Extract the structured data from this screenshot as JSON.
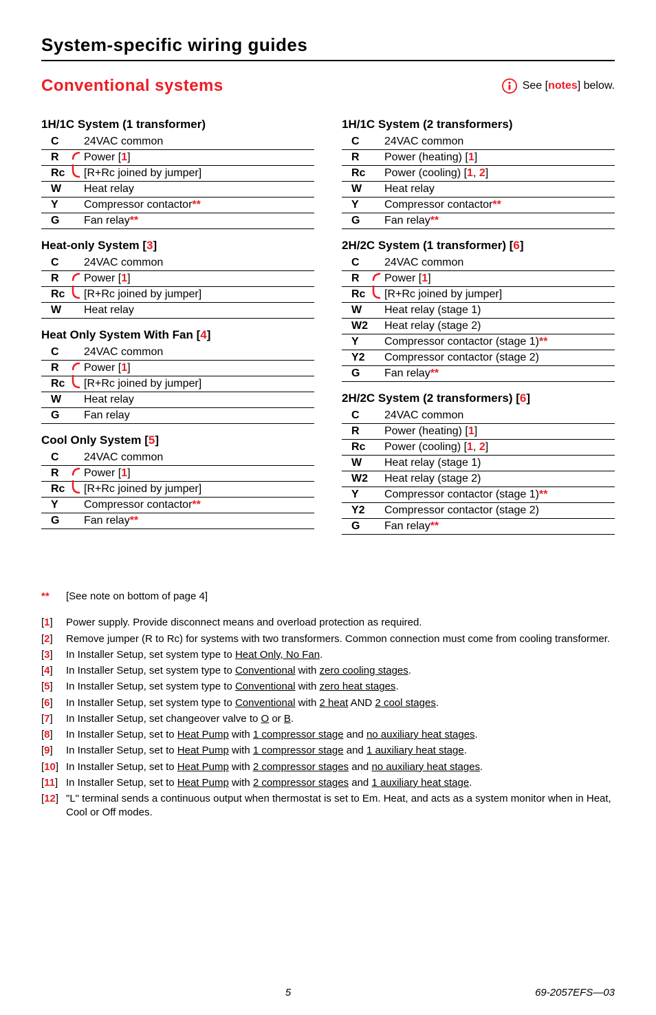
{
  "header": "System-specific wiring guides",
  "section": "Conventional systems",
  "info_notes": {
    "pre": "See [",
    "mid": "notes",
    "post": "] below."
  },
  "systems": {
    "s1": {
      "title": "1H/1C System (1 transformer)",
      "rows": [
        {
          "term": "C",
          "desc": "24VAC common",
          "j": ""
        },
        {
          "term": "R",
          "desc_pre": "Power [",
          "ref": "1",
          "desc_post": "]",
          "j": "top"
        },
        {
          "term": "Rc",
          "desc": "[R+Rc joined by jumper]",
          "j": "bot"
        },
        {
          "term": "W",
          "desc": "Heat relay",
          "j": ""
        },
        {
          "term": "Y",
          "desc_pre": "Compressor contactor",
          "star": "**",
          "j": ""
        },
        {
          "term": "G",
          "desc_pre": "Fan relay",
          "star": "**",
          "j": ""
        }
      ]
    },
    "s2": {
      "title_pre": "Heat-only System [",
      "title_ref": "3",
      "title_post": "]",
      "rows": [
        {
          "term": "C",
          "desc": "24VAC common",
          "j": ""
        },
        {
          "term": "R",
          "desc_pre": "Power [",
          "ref": "1",
          "desc_post": "]",
          "j": "top"
        },
        {
          "term": "Rc",
          "desc": "[R+Rc joined by jumper]",
          "j": "bot"
        },
        {
          "term": "W",
          "desc": "Heat relay",
          "j": ""
        }
      ]
    },
    "s3": {
      "title_pre": "Heat Only System With Fan [",
      "title_ref": "4",
      "title_post": "]",
      "rows": [
        {
          "term": "C",
          "desc": "24VAC common",
          "j": ""
        },
        {
          "term": "R",
          "desc_pre": "Power [",
          "ref": "1",
          "desc_post": "]",
          "j": "top"
        },
        {
          "term": "Rc",
          "desc": "[R+Rc joined by jumper]",
          "j": "bot"
        },
        {
          "term": "W",
          "desc": "Heat relay",
          "j": ""
        },
        {
          "term": "G",
          "desc": "Fan relay",
          "j": ""
        }
      ]
    },
    "s4": {
      "title_pre": "Cool Only System [",
      "title_ref": "5",
      "title_post": "]",
      "rows": [
        {
          "term": "C",
          "desc": "24VAC common",
          "j": ""
        },
        {
          "term": "R",
          "desc_pre": "Power [",
          "ref": "1",
          "desc_post": "]",
          "j": "top"
        },
        {
          "term": "Rc",
          "desc": "[R+Rc joined by jumper]",
          "j": "bot"
        },
        {
          "term": "Y",
          "desc_pre": "Compressor contactor",
          "star": "**",
          "j": ""
        },
        {
          "term": "G",
          "desc_pre": "Fan relay",
          "star": "**",
          "j": ""
        }
      ]
    },
    "s5": {
      "title": "1H/1C System (2 transformers)",
      "rows": [
        {
          "term": "C",
          "desc": "24VAC common",
          "j": ""
        },
        {
          "term": "R",
          "desc_pre": "Power (heating) [",
          "ref": "1",
          "desc_post": "]",
          "j": ""
        },
        {
          "term": "Rc",
          "desc_pre": "Power (cooling) [",
          "ref": "1",
          "ref2": "2",
          "desc_post": "]",
          "j": ""
        },
        {
          "term": "W",
          "desc": "Heat relay",
          "j": ""
        },
        {
          "term": "Y",
          "desc_pre": "Compressor contactor",
          "star": "**",
          "j": ""
        },
        {
          "term": "G",
          "desc_pre": "Fan relay",
          "star": "**",
          "j": ""
        }
      ]
    },
    "s6": {
      "title_pre": "2H/2C System (1 transformer) [",
      "title_ref": "6",
      "title_post": "]",
      "rows": [
        {
          "term": "C",
          "desc": "24VAC common",
          "j": ""
        },
        {
          "term": "R",
          "desc_pre": "Power [",
          "ref": "1",
          "desc_post": "]",
          "j": "top"
        },
        {
          "term": "Rc",
          "desc": "[R+Rc joined by jumper]",
          "j": "bot"
        },
        {
          "term": "W",
          "desc": "Heat relay (stage 1)",
          "j": ""
        },
        {
          "term": "W2",
          "desc": "Heat relay (stage 2)",
          "j": ""
        },
        {
          "term": "Y",
          "desc_pre": "Compressor contactor (stage 1)",
          "star": "**",
          "j": ""
        },
        {
          "term": "Y2",
          "desc": "Compressor contactor (stage 2)",
          "j": ""
        },
        {
          "term": "G",
          "desc_pre": "Fan relay",
          "star": "**",
          "j": ""
        }
      ]
    },
    "s7": {
      "title_pre": "2H/2C System (2 transformers) [",
      "title_ref": "6",
      "title_post": "]",
      "rows": [
        {
          "term": "C",
          "desc": "24VAC common",
          "j": ""
        },
        {
          "term": "R",
          "desc_pre": "Power (heating) [",
          "ref": "1",
          "desc_post": "]",
          "j": ""
        },
        {
          "term": "Rc",
          "desc_pre": "Power (cooling) [",
          "ref": "1",
          "ref2": "2",
          "desc_post": "]",
          "j": ""
        },
        {
          "term": "W",
          "desc": "Heat relay (stage 1)",
          "j": ""
        },
        {
          "term": "W2",
          "desc": "Heat relay (stage 2)",
          "j": ""
        },
        {
          "term": "Y",
          "desc_pre": "Compressor contactor (stage 1)",
          "star": "**",
          "j": ""
        },
        {
          "term": "Y2",
          "desc": "Compressor contactor (stage 2)",
          "j": ""
        },
        {
          "term": "G",
          "desc_pre": "Fan relay",
          "star": "**",
          "j": ""
        }
      ]
    }
  },
  "notes": [
    {
      "key": "**",
      "text": "[See note on bottom of page 4]",
      "red_key": true,
      "plain": true
    },
    {
      "key": "1",
      "text": "Power supply. Provide disconnect means and overload protection as required."
    },
    {
      "key": "2",
      "text": "Remove jumper (R to Rc) for systems with two transformers. Common connection must come from cooling transformer."
    },
    {
      "key": "3",
      "pre": "In Installer Setup, set system type to ",
      "u1": "Heat Only, No Fan",
      "post": "."
    },
    {
      "key": "4",
      "pre": "In Installer Setup, set system type to ",
      "u1": "Conventional",
      "mid": " with ",
      "u2": "zero cooling stages",
      "post": "."
    },
    {
      "key": "5",
      "pre": "In Installer Setup, set system type to ",
      "u1": "Conventional",
      "mid": " with ",
      "u2": "zero heat stages",
      "post": "."
    },
    {
      "key": "6",
      "pre": "In Installer Setup, set system type to ",
      "u1": "Conventional",
      "mid": " with ",
      "u2": "2 heat",
      "mid2": " AND ",
      "u3": "2 cool stages",
      "post": "."
    },
    {
      "key": "7",
      "pre": "In Installer Setup, set changeover valve to ",
      "u1": "O",
      "mid": " or ",
      "u2": "B",
      "post": "."
    },
    {
      "key": "8",
      "pre": "In Installer Setup, set to ",
      "u1": "Heat Pump",
      "mid": " with ",
      "u2": "1 compressor stage",
      "mid2": " and ",
      "u3": "no auxiliary heat stages",
      "post": "."
    },
    {
      "key": "9",
      "pre": "In Installer Setup, set to ",
      "u1": "Heat Pump",
      "mid": " with ",
      "u2": "1 compressor stage",
      "mid2": " and ",
      "u3": "1 auxiliary heat stage",
      "post": "."
    },
    {
      "key": "10",
      "pre": "In Installer Setup, set to ",
      "u1": "Heat Pump",
      "mid": " with ",
      "u2": "2 compressor stages",
      "mid2": " and ",
      "u3": "no auxiliary heat stages",
      "post": "."
    },
    {
      "key": "11",
      "pre": "In Installer Setup, set to ",
      "u1": "Heat Pump",
      "mid": " with ",
      "u2": "2 compressor stages",
      "mid2": " and ",
      "u3": "1 auxiliary heat stage",
      "post": "."
    },
    {
      "key": "12",
      "text": "\"L\" terminal sends a continuous output when thermostat is set to Em. Heat, and acts as a system monitor when in Heat, Cool or Off modes."
    }
  ],
  "footer": {
    "page": "5",
    "doc": "69-2057EFS—03"
  }
}
